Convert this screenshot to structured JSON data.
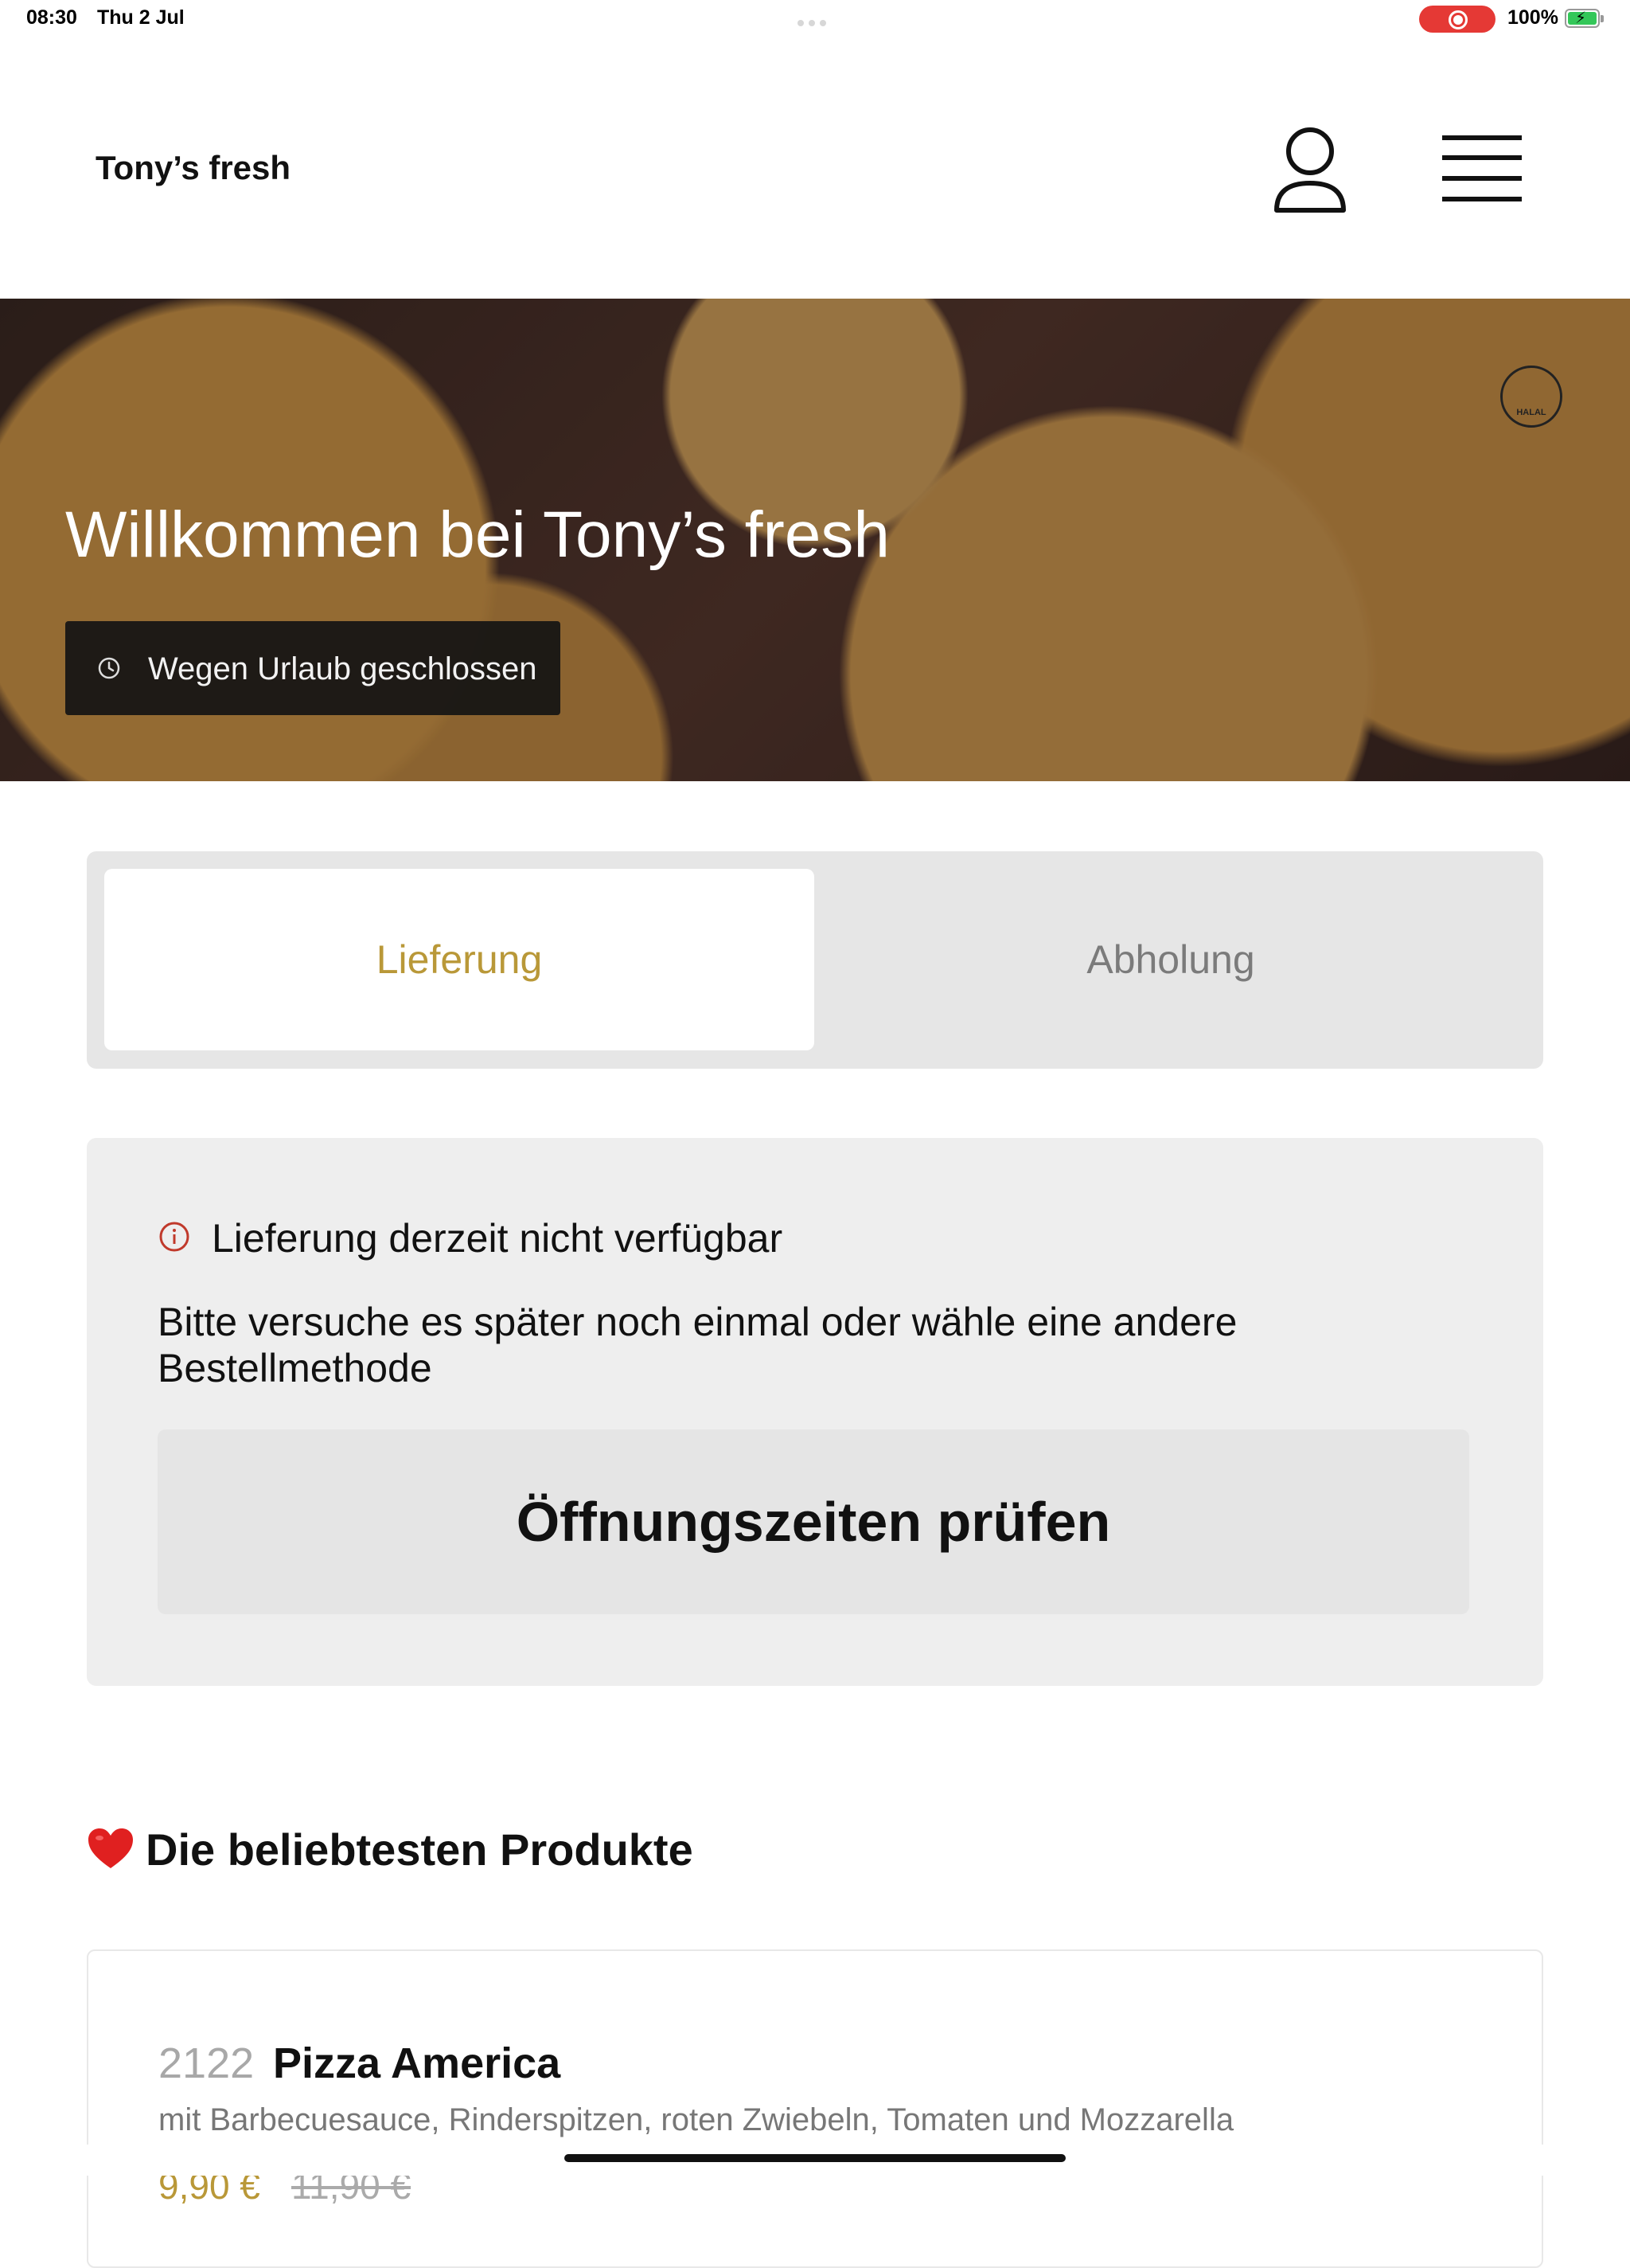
{
  "status_bar": {
    "time": "08:30",
    "date": "Thu 2 Jul",
    "battery": "100%",
    "recording_color": "#e53935",
    "battery_color": "#34c759"
  },
  "header": {
    "brand": "Tony’s fresh",
    "user_icon": "user-icon",
    "menu_icon": "menu-icon"
  },
  "hero": {
    "title": "Willkommen bei Tony’s fresh",
    "status": "Wegen Urlaub geschlossen",
    "halal_label": "HALAL"
  },
  "order_mode": {
    "options": [
      "Lieferung",
      "Abholung"
    ],
    "selected": "Lieferung",
    "accent": "#b99838"
  },
  "notice": {
    "title": "Lieferung derzeit nicht verfügbar",
    "text": "Bitte versuche es später noch einmal oder wähle eine andere Bestellmethode",
    "button": "Öffnungszeiten prüfen"
  },
  "popular": {
    "title": "Die beliebtesten Produkte",
    "products": [
      {
        "number": "2122",
        "name": "Pizza America",
        "description": "mit Barbecuesauce, Rinderspitzen, roten Zwiebeln, Tomaten und Mozzarella",
        "price": "9,90 €",
        "old_price": "11,90 €"
      }
    ]
  }
}
